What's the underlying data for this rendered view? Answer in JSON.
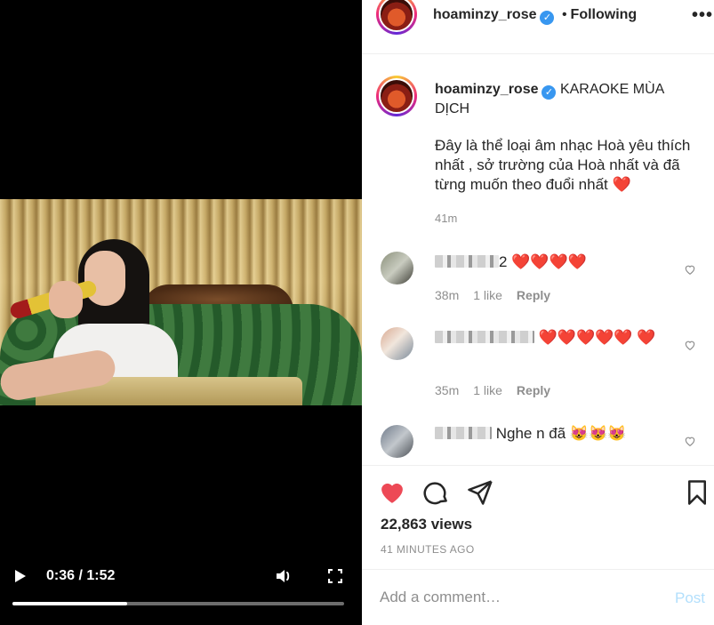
{
  "video": {
    "time_display": "0:36 / 1:52",
    "progress_fraction": 0.345
  },
  "header": {
    "username": "hoaminzy_rose",
    "separator": "•",
    "follow_status": "Following",
    "more": "•••"
  },
  "caption": {
    "username": "hoaminzy_rose",
    "title": "KARAOKE MÙA DỊCH",
    "body": "Đây là thể loại âm nhạc Hoà yêu thích nhất , sở trường của Hoà nhất và đã từng muốn theo đuổi nhất",
    "body_emoji": "❤️",
    "time": "41m"
  },
  "comments": [
    {
      "name_suffix": "2",
      "text": "❤️❤️❤️❤️",
      "time": "38m",
      "likes": "1 like",
      "reply": "Reply"
    },
    {
      "name_suffix": "",
      "text": "❤️❤️❤️❤️❤️ ❤️",
      "time": "35m",
      "likes": "1 like",
      "reply": "Reply"
    },
    {
      "name_suffix": "",
      "text": "Nghe n đã 😻😻😻",
      "time": "",
      "likes": "",
      "reply": ""
    }
  ],
  "stats": {
    "views": "22,863 views",
    "timestamp": "41 MINUTES AGO"
  },
  "add_comment": {
    "placeholder": "Add a comment…",
    "post_label": "Post"
  },
  "colors": {
    "like_red": "#ed4956",
    "verified_blue": "#3897f0",
    "post_disabled": "#b2dffc",
    "muted_text": "#8e8e8e"
  },
  "icons": [
    "play-icon",
    "volume-icon",
    "fullscreen-icon",
    "verified-icon",
    "more-icon",
    "heart-icon",
    "comment-icon",
    "share-icon",
    "bookmark-icon"
  ]
}
